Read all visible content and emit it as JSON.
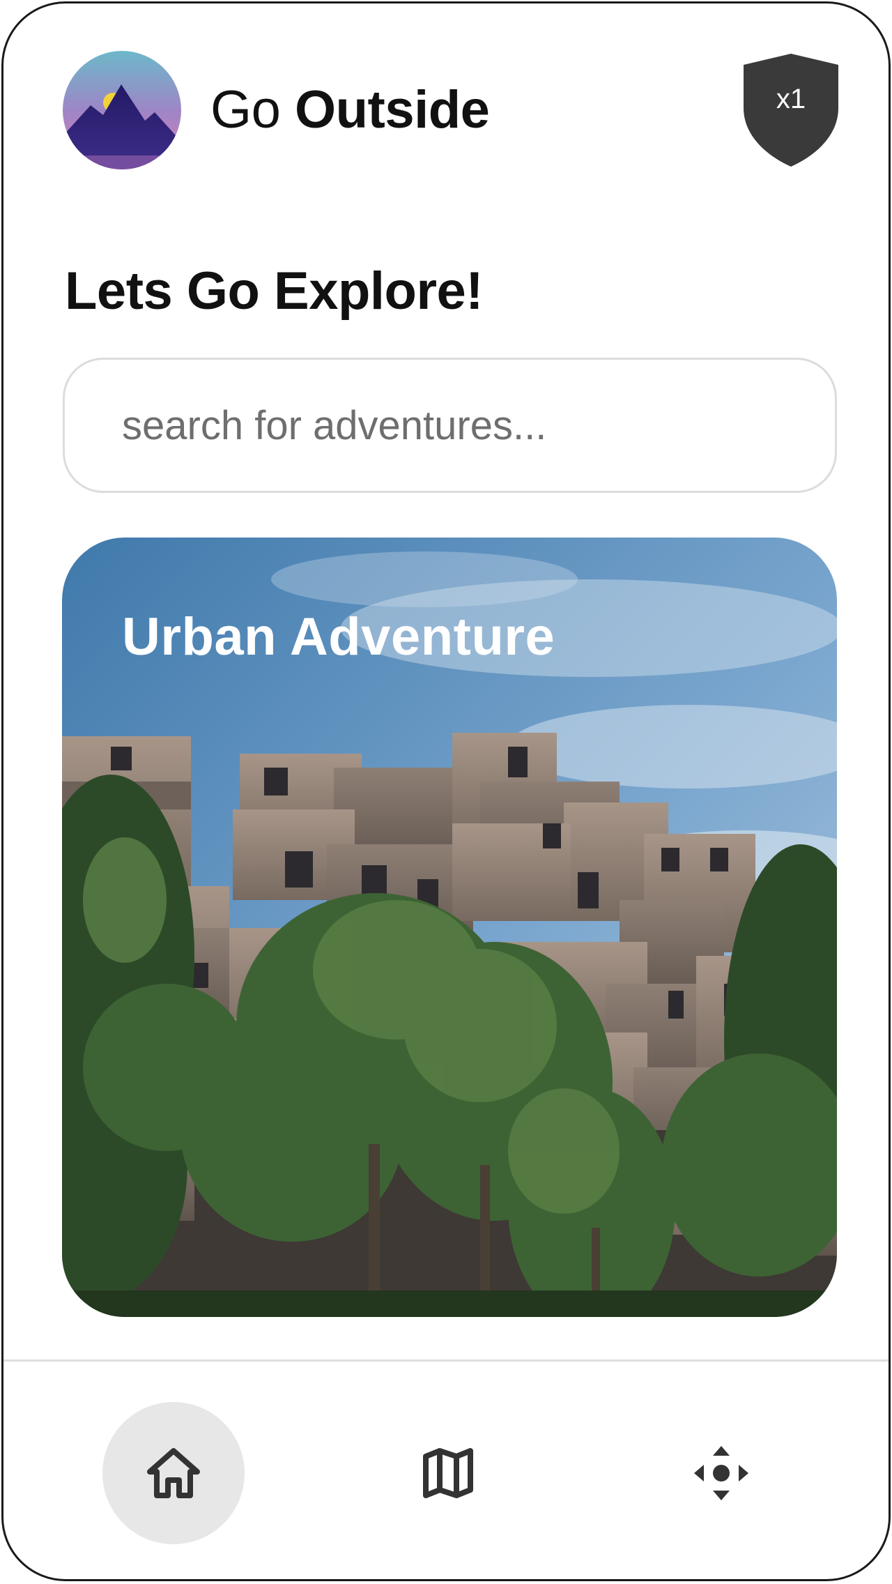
{
  "header": {
    "title_light": "Go",
    "title_bold": "Outside",
    "logo_icon": "mountain-sunset-logo",
    "badge": {
      "icon": "shield-icon",
      "label": "x1"
    }
  },
  "main": {
    "heading": "Lets Go Explore!",
    "search": {
      "placeholder": "search for adventures...",
      "value": ""
    },
    "cards": [
      {
        "title": "Urban Adventure",
        "image": "brutalist-apartment-complex-photo"
      }
    ]
  },
  "nav": {
    "items": [
      {
        "icon": "home-icon",
        "active": true
      },
      {
        "icon": "map-icon",
        "active": false
      },
      {
        "icon": "move-arrows-icon",
        "active": false
      }
    ]
  },
  "colors": {
    "text": "#111111",
    "badge": "#3a3a3a",
    "active_nav_bg": "#e7e7e7",
    "logo_gradient": [
      "#6fb3c8",
      "#9a7fc4",
      "#e07ab6"
    ],
    "logo_mountain": "#2a1f6e",
    "logo_sun": "#f2d23a"
  }
}
